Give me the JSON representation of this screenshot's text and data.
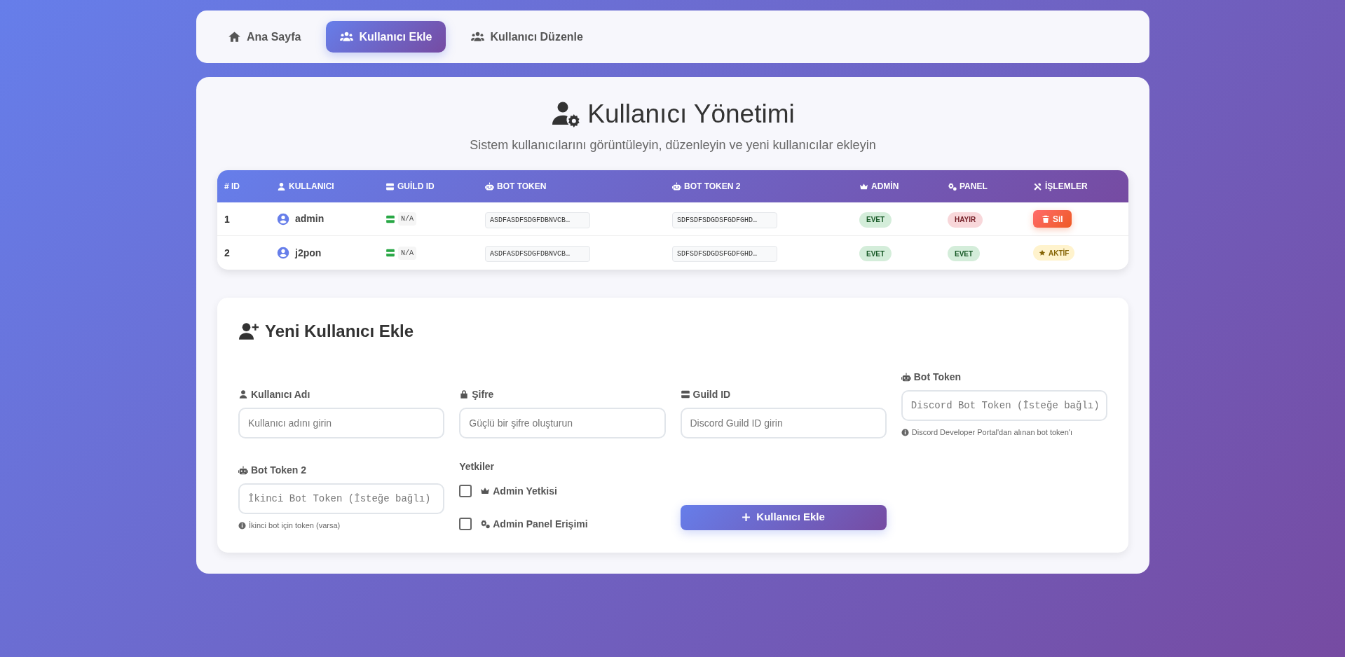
{
  "nav": {
    "tabs": [
      {
        "label": "Ana Sayfa",
        "selected": false
      },
      {
        "label": "Kullanıcı Ekle",
        "selected": true
      },
      {
        "label": "Kullanıcı Düzenle",
        "selected": false
      }
    ]
  },
  "header": {
    "title": "Kullanıcı Yönetimi",
    "subtitle": "Sistem kullanıcılarını görüntüleyin, düzenleyin ve yeni kullanıcılar ekleyin"
  },
  "table": {
    "columns": [
      "# ID",
      "KULLANICI",
      "GUİLD ID",
      "BOT TOKEN",
      "BOT TOKEN 2",
      "ADMİN",
      "PANEL",
      "İŞLEMLER"
    ],
    "rows": [
      {
        "id": "1",
        "user": "admin",
        "guild_id": "N/A",
        "bot_token": "ASDFASDFSDGFDBNVCB…",
        "bot_token_2": "SDFSDFSDGDSFGDFGHD…",
        "admin": {
          "label": "EVET",
          "kind": "yes"
        },
        "panel": {
          "label": "HAYIR",
          "kind": "no"
        },
        "action": {
          "label": "Sil",
          "kind": "delete_button"
        }
      },
      {
        "id": "2",
        "user": "j2pon",
        "guild_id": "N/A",
        "bot_token": "ASDFASDFSDGFDBNVCB…",
        "bot_token_2": "SDFSDFSDGDSFGDFGHD…",
        "admin": {
          "label": "EVET",
          "kind": "yes"
        },
        "panel": {
          "label": "EVET",
          "kind": "yes"
        },
        "action": {
          "label": "AKTİF",
          "kind": "status_badge"
        }
      }
    ]
  },
  "form": {
    "title": "Yeni Kullanıcı Ekle",
    "fields": [
      {
        "label": "Kullanıcı Adı",
        "placeholder": "Kullanıcı adını girin",
        "kind": "text"
      },
      {
        "label": "Şifre",
        "placeholder": "Güçlü bir şifre oluşturun",
        "kind": "text"
      },
      {
        "label": "Guild ID",
        "placeholder": "Discord Guild ID girin",
        "kind": "text"
      },
      {
        "label": "Bot Token",
        "placeholder": "Discord Bot Token (İsteğe bağlı)",
        "kind": "token",
        "help": "Discord Developer Portal'dan alınan bot token'ı"
      },
      {
        "label": "Bot Token 2",
        "placeholder": "İkinci Bot Token (İsteğe bağlı)",
        "kind": "token",
        "help": "İkinci bot için token (varsa)"
      }
    ],
    "permissions": {
      "heading": "Yetkiler",
      "options": [
        {
          "label": "Admin Yetkisi",
          "checked": false
        },
        {
          "label": "Admin Panel Erişimi",
          "checked": false
        }
      ]
    },
    "submit": "Kullanıcı Ekle"
  }
}
